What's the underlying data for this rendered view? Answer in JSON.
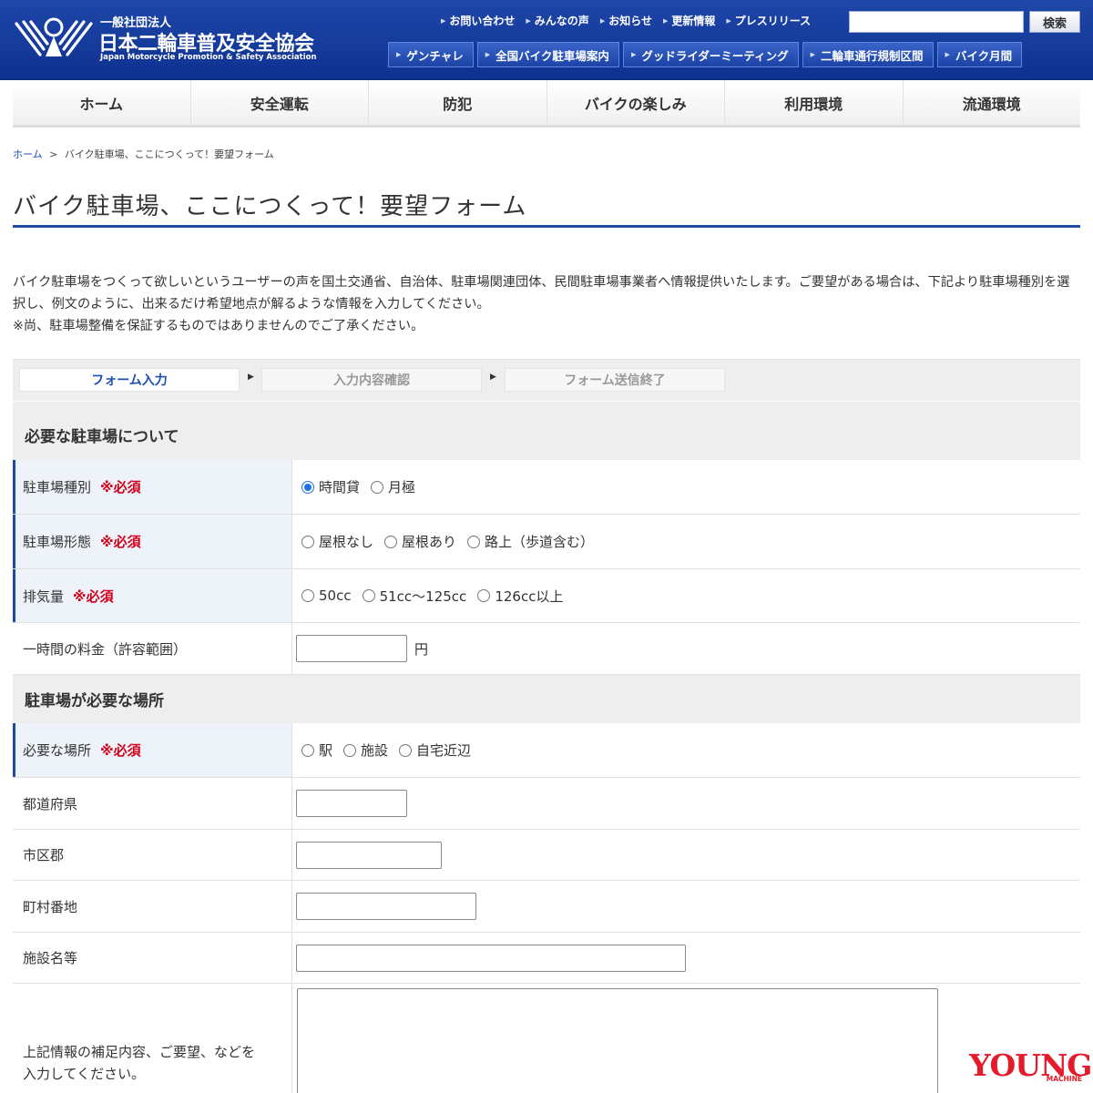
{
  "header": {
    "logo": {
      "line1": "一般社団法人",
      "line2": "日本二輪車普及安全協会",
      "line3": "Japan Motorcycle Promotion & Safety Association"
    },
    "top_links": [
      "お問い合わせ",
      "みんなの声",
      "お知らせ",
      "更新情報",
      "プレスリリース"
    ],
    "search_button": "検索",
    "sub_buttons": [
      "ゲンチャレ",
      "全国バイク駐車場案内",
      "グッドライダーミーティング",
      "二輪車通行規制区間",
      "バイク月間"
    ]
  },
  "global_nav": [
    "ホーム",
    "安全運転",
    "防犯",
    "バイクの楽しみ",
    "利用環境",
    "流通環境"
  ],
  "breadcrumb": {
    "home": "ホーム",
    "separator": ">",
    "current": "バイク駐車場、ここにつくって！要望フォーム"
  },
  "page_title": "バイク駐車場、ここにつくって！要望フォーム",
  "intro": {
    "p1": "バイク駐車場をつくって欲しいというユーザーの声を国土交通省、自治体、駐車場関連団体、民間駐車場事業者へ情報提供いたします。ご要望がある場合は、下記より駐車場種別を選択し、例文のように、出来るだけ希望地点が解るような情報を入力してください。",
    "p2": "※尚、駐車場整備を保証するものではありませんのでご了承ください。"
  },
  "steps": [
    "フォーム入力",
    "入力内容確認",
    "フォーム送信終了"
  ],
  "required_mark": "※必須",
  "section1": {
    "title": "必要な駐車場について",
    "parking_type": {
      "label": "駐車場種別",
      "options": [
        "時間貸",
        "月極"
      ],
      "selected": "時間貸"
    },
    "parking_form": {
      "label": "駐車場形態",
      "options": [
        "屋根なし",
        "屋根あり",
        "路上（歩道含む）"
      ]
    },
    "displacement": {
      "label": "排気量",
      "options": [
        "50cc",
        "51cc〜125cc",
        "126cc以上"
      ]
    },
    "hourly_fee": {
      "label": "一時間の料金（許容範囲）",
      "value": "",
      "unit": "円"
    }
  },
  "section2": {
    "title": "駐車場が必要な場所",
    "place": {
      "label": "必要な場所",
      "options": [
        "駅",
        "施設",
        "自宅近辺"
      ]
    },
    "prefecture": {
      "label": "都道府県",
      "value": ""
    },
    "city": {
      "label": "市区郡",
      "value": ""
    },
    "address": {
      "label": "町村番地",
      "value": ""
    },
    "facility": {
      "label": "施設名等",
      "value": ""
    },
    "remarks": {
      "label_line1": "上記情報の補足内容、ご要望、などを",
      "label_line2": "入力してください。",
      "value": ""
    }
  },
  "watermark": {
    "brand": "YOUNG",
    "sub": "MACHINE"
  }
}
